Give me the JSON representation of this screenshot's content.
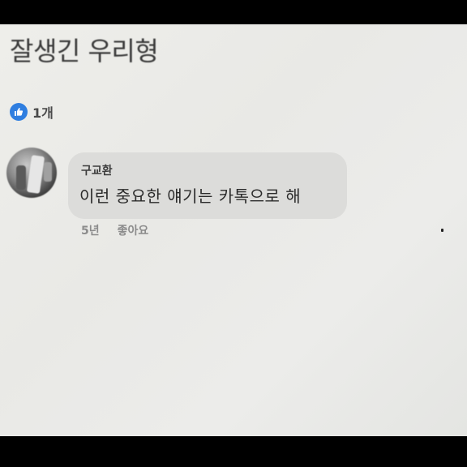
{
  "post": {
    "title": "잘생긴 우리형"
  },
  "reactions": {
    "icon": "like-icon",
    "accent_color": "#2f7ee0",
    "count_label": "1개"
  },
  "comment": {
    "author": "구교환",
    "text": "이런 중요한 얘기는 카톡으로 해",
    "time": "5년",
    "like_label": "좋아요"
  }
}
